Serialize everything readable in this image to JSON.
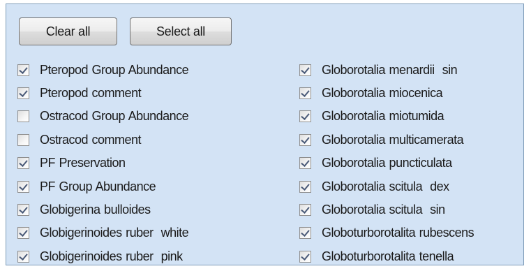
{
  "buttons": {
    "clear_all": "Clear all",
    "select_all": "Select all"
  },
  "colors": {
    "panel_background": "#d3e3f5",
    "panel_border": "#7f9db9",
    "check_mark": "#4a5a78"
  },
  "left_column": [
    {
      "label": "Pteropod Group Abundance",
      "checked": true
    },
    {
      "label": "Pteropod comment",
      "checked": true
    },
    {
      "label": "Ostracod Group Abundance",
      "checked": false
    },
    {
      "label": "Ostracod comment",
      "checked": false
    },
    {
      "label": "PF Preservation",
      "checked": true
    },
    {
      "label": "PF Group Abundance",
      "checked": true
    },
    {
      "label": "Globigerina bulloides",
      "checked": true
    },
    {
      "label": "Globigerinoides ruber  white",
      "checked": true
    },
    {
      "label": "Globigerinoides ruber  pink",
      "checked": true
    }
  ],
  "right_column": [
    {
      "label": "Globorotalia menardii  sin",
      "checked": true
    },
    {
      "label": "Globorotalia miocenica",
      "checked": true
    },
    {
      "label": "Globorotalia miotumida",
      "checked": true
    },
    {
      "label": "Globorotalia multicamerata",
      "checked": true
    },
    {
      "label": "Globorotalia puncticulata",
      "checked": true
    },
    {
      "label": "Globorotalia scitula  dex",
      "checked": true
    },
    {
      "label": "Globorotalia scitula  sin",
      "checked": true
    },
    {
      "label": "Globoturborotalita rubescens",
      "checked": true
    },
    {
      "label": "Globoturborotalita tenella",
      "checked": true
    }
  ]
}
